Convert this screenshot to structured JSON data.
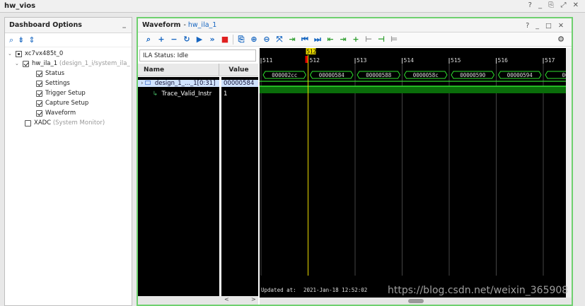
{
  "window": {
    "title": "hw_vios",
    "controls": "? _ ⎘ ⤢ ✕"
  },
  "dashboard": {
    "title": "Dashboard Options",
    "minimize": "_",
    "tree": {
      "device": "xc7vx485t_0",
      "ila": "hw_ila_1",
      "ila_path": "(design_1_i/system_ila_",
      "items": [
        "Status",
        "Settings",
        "Trigger Setup",
        "Capture Setup",
        "Waveform"
      ],
      "xadc_label": "XADC",
      "xadc_suffix": "(System Monitor)"
    }
  },
  "waveform": {
    "title": "Waveform",
    "link": "hw_ila_1",
    "controls": "? _ □ ✕",
    "ila_status": "ILA Status: Idle",
    "columns": {
      "name": "Name",
      "value": "Value"
    },
    "signals": [
      {
        "name": "design_1_..._1[0:31]",
        "value": "00000584"
      },
      {
        "name": "Trace_Valid_Instr",
        "value": "1"
      }
    ],
    "marker_label": "512",
    "ticks": [
      "511",
      "512",
      "513",
      "514",
      "515",
      "516",
      "517"
    ],
    "bus_values": [
      "000002cc",
      "00000584",
      "00000588",
      "0000058c",
      "00000590",
      "00000594",
      "000"
    ],
    "updated_label": "Updated at:",
    "updated_time": "2021-Jan-18 12:52:02",
    "scroll_left": "<",
    "scroll_right": ">"
  },
  "watermark": "https://blog.csdn.net/weixin_365908"
}
